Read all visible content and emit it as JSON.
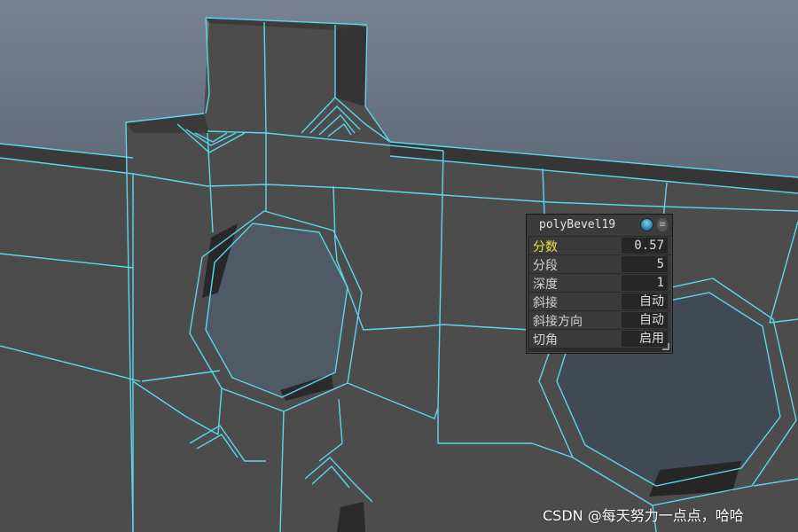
{
  "panel": {
    "node_name": "polyBevel19",
    "rows": [
      {
        "label": "分数",
        "value": "0.57",
        "active": true
      },
      {
        "label": "分段",
        "value": "5",
        "active": false
      },
      {
        "label": "深度",
        "value": "1",
        "active": false
      },
      {
        "label": "斜接",
        "value": "自动",
        "active": false
      },
      {
        "label": "斜接方向",
        "value": "自动",
        "active": false
      },
      {
        "label": "切角",
        "value": "启用",
        "active": false
      }
    ],
    "pin_icon": "pin-icon",
    "menu_icon": "menu-icon"
  },
  "watermark": "CSDN @每天努力一点点，哈哈",
  "colors": {
    "wire": "#5ad7ea",
    "face": "#4a4a4a",
    "face_dark": "#2f2f2f",
    "active_label": "#f0e23c"
  }
}
